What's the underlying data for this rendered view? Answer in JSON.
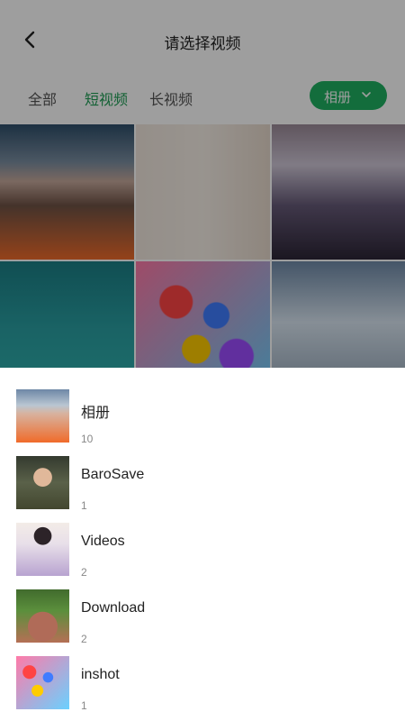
{
  "header": {
    "back_icon": "chevron-left-icon",
    "title": "请选择视频"
  },
  "tabs": [
    {
      "label": "全部",
      "active": false
    },
    {
      "label": "短视频",
      "active": true
    },
    {
      "label": "长视频",
      "active": false
    }
  ],
  "album_button": {
    "label": "相册",
    "icon": "chevron-down-icon",
    "color": "#20b062"
  },
  "accent_color": "#1f9d55",
  "grid_items": [
    "beach-sunset",
    "woman-portrait",
    "wedding-hall",
    "sea-girl",
    "balloons",
    "clouds"
  ],
  "albums": [
    {
      "name": "相册",
      "count": "10"
    },
    {
      "name": "BaroSave",
      "count": "1"
    },
    {
      "name": "Videos",
      "count": "2"
    },
    {
      "name": "Download",
      "count": "2"
    },
    {
      "name": "inshot",
      "count": "1"
    }
  ]
}
